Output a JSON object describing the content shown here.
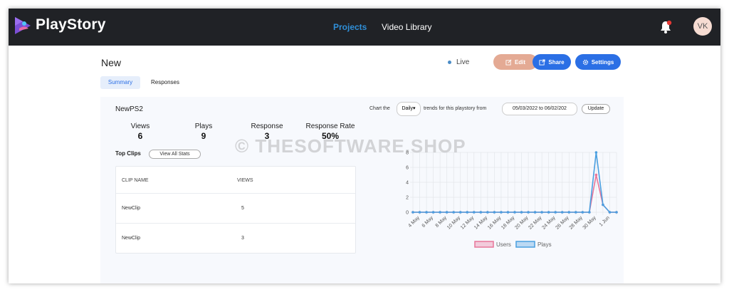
{
  "app": {
    "brand": "PlayStory"
  },
  "nav": {
    "projects": "Projects",
    "video_library": "Video Library"
  },
  "user": {
    "initials": "VK"
  },
  "page": {
    "title": "New",
    "status": "Live"
  },
  "actions": {
    "edit": "Edit",
    "share": "Share",
    "settings": "Settings"
  },
  "tabs": {
    "summary": "Summary",
    "responses": "Responses"
  },
  "summary": {
    "playstory_name": "NewPS2",
    "stats": [
      {
        "label": "Views",
        "value": "6"
      },
      {
        "label": "Plays",
        "value": "9"
      },
      {
        "label": "Response",
        "value": "3"
      },
      {
        "label": "Response Rate",
        "value": "50%"
      }
    ],
    "top_clips_label": "Top Clips",
    "view_all_label": "View All Stats",
    "table": {
      "headers": [
        "CLIP NAME",
        "VIEWS"
      ],
      "rows": [
        {
          "name": "NewClip",
          "views": "5"
        },
        {
          "name": "NewClip",
          "views": "3"
        }
      ]
    }
  },
  "chart_controls": {
    "prefix": "Chart the",
    "interval": "Daily",
    "suffix": "trends for this playstory from",
    "date_range": "05/03/2022 to 06/02/202",
    "update_label": "Update"
  },
  "watermark": "© THESOFTWARE.SHOP",
  "chart_data": {
    "type": "line",
    "x_tick_labels": [
      "4 May",
      "6 May",
      "8 May",
      "10 May",
      "12 May",
      "14 May",
      "16 May",
      "18 May",
      "20 May",
      "22 May",
      "24 May",
      "26 May",
      "28 May",
      "30 May",
      "1 Jun"
    ],
    "x": [
      "3 May",
      "4 May",
      "5 May",
      "6 May",
      "7 May",
      "8 May",
      "9 May",
      "10 May",
      "11 May",
      "12 May",
      "13 May",
      "14 May",
      "15 May",
      "16 May",
      "17 May",
      "18 May",
      "19 May",
      "20 May",
      "21 May",
      "22 May",
      "23 May",
      "24 May",
      "25 May",
      "26 May",
      "27 May",
      "28 May",
      "29 May",
      "30 May",
      "31 May",
      "1 Jun",
      "2 Jun"
    ],
    "series": [
      {
        "name": "Users",
        "color": "#e8769a",
        "values": [
          0,
          0,
          0,
          0,
          0,
          0,
          0,
          0,
          0,
          0,
          0,
          0,
          0,
          0,
          0,
          0,
          0,
          0,
          0,
          0,
          0,
          0,
          0,
          0,
          0,
          0,
          0,
          5,
          1,
          0,
          0
        ]
      },
      {
        "name": "Plays",
        "color": "#4a9fe0",
        "values": [
          0,
          0,
          0,
          0,
          0,
          0,
          0,
          0,
          0,
          0,
          0,
          0,
          0,
          0,
          0,
          0,
          0,
          0,
          0,
          0,
          0,
          0,
          0,
          0,
          0,
          0,
          0,
          8,
          1,
          0,
          0
        ]
      }
    ],
    "ylim": [
      0,
      8
    ],
    "y_ticks": [
      0,
      2,
      4,
      6,
      8
    ],
    "grid": true,
    "legend_position": "bottom"
  }
}
